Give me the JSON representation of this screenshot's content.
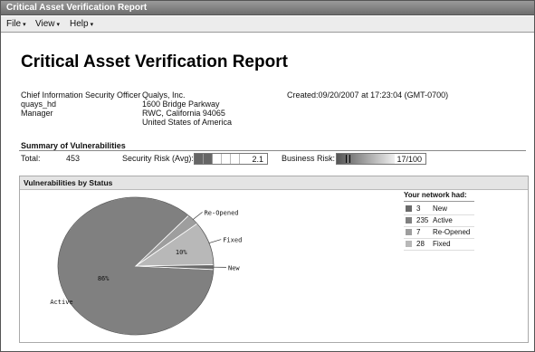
{
  "window": {
    "title": "Critical Asset Verification Report"
  },
  "menu": [
    {
      "label": "File"
    },
    {
      "label": "View"
    },
    {
      "label": "Help"
    }
  ],
  "report": {
    "title": "Critical Asset Verification Report",
    "role": [
      "Chief Information Security Officer",
      "quays_hd",
      "Manager"
    ],
    "company": [
      "Qualys, Inc.",
      "1600 Bridge Parkway",
      "RWC, California 94065",
      "United States of America"
    ],
    "created": "Created:09/20/2007 at 17:23:04 (GMT-0700)"
  },
  "summary": {
    "title": "Summary of Vulnerabilities",
    "total_label": "Total:",
    "total_value": "453",
    "security_risk_label": "Security Risk (Avg):",
    "security_risk_value": "2.1",
    "security_risk_level": 2.1,
    "business_risk_label": "Business Risk:",
    "business_risk_value": "17/100",
    "business_risk_level": 0.17
  },
  "status_panel": {
    "title": "Vulnerabilities by Status",
    "legend_title": "Your network had:",
    "legend": [
      {
        "count": "3",
        "label": "New",
        "color": "#6a6a6a"
      },
      {
        "count": "235",
        "label": "Active",
        "color": "#808080"
      },
      {
        "count": "7",
        "label": "Re-Opened",
        "color": "#9e9e9e"
      },
      {
        "count": "28",
        "label": "Fixed",
        "color": "#b8b8b8"
      }
    ]
  },
  "chart_data": {
    "type": "pie",
    "slices": [
      {
        "label": "Active",
        "value": 235,
        "percent_label": "86%",
        "color": "#808080"
      },
      {
        "label": "Re-Opened",
        "value": 7,
        "percent_label": "",
        "color": "#9e9e9e"
      },
      {
        "label": "Fixed",
        "value": 28,
        "percent_label": "10%",
        "color": "#b8b8b8"
      },
      {
        "label": "New",
        "value": 3,
        "percent_label": "",
        "color": "#6a6a6a"
      }
    ]
  }
}
